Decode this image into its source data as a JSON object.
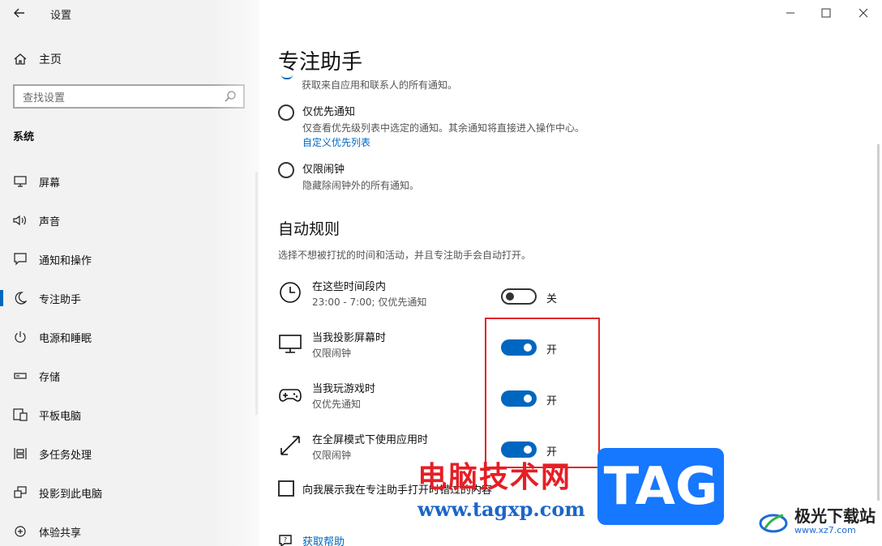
{
  "app": {
    "title": "设置",
    "back_icon": "back-arrow-icon"
  },
  "window_controls": {
    "minimize": "minimize-icon",
    "maximize": "maximize-icon",
    "close": "close-icon"
  },
  "sidebar": {
    "home_label": "主页",
    "search_placeholder": "查找设置",
    "section": "系统",
    "items": [
      {
        "label": "屏幕",
        "icon": "monitor-icon"
      },
      {
        "label": "声音",
        "icon": "speaker-icon"
      },
      {
        "label": "通知和操作",
        "icon": "message-icon"
      },
      {
        "label": "专注助手",
        "icon": "moon-icon",
        "active": true
      },
      {
        "label": "电源和睡眠",
        "icon": "power-icon"
      },
      {
        "label": "存储",
        "icon": "storage-icon"
      },
      {
        "label": "平板电脑",
        "icon": "tablet-icon"
      },
      {
        "label": "多任务处理",
        "icon": "multitask-icon"
      },
      {
        "label": "投影到此电脑",
        "icon": "project-icon"
      },
      {
        "label": "体验共享",
        "icon": "share-icon"
      }
    ]
  },
  "main": {
    "title": "专注助手",
    "partial_desc": "获取来自应用和联系人的所有通知。",
    "options": [
      {
        "title": "仅优先通知",
        "desc": "仅查看优先级列表中选定的通知。其余通知将直接进入操作中心。",
        "link": "自定义优先列表"
      },
      {
        "title": "仅限闹钟",
        "desc": "隐藏除闹钟外的所有通知。"
      }
    ],
    "auto_rules": {
      "heading": "自动规则",
      "desc": "选择不想被打扰的时间和活动，并且专注助手会自动打开。",
      "rules": [
        {
          "title": "在这些时间段内",
          "desc": "23:00 - 7:00; 仅优先通知",
          "state": "关",
          "on": false,
          "icon": "clock-icon"
        },
        {
          "title": "当我投影屏幕时",
          "desc": "仅限闹钟",
          "state": "开",
          "on": true,
          "icon": "monitor-icon"
        },
        {
          "title": "当我玩游戏时",
          "desc": "仅优先通知",
          "state": "开",
          "on": true,
          "icon": "gamepad-icon"
        },
        {
          "title": "在全屏模式下使用应用时",
          "desc": "仅限闹钟",
          "state": "开",
          "on": true,
          "icon": "resize-diagonal-icon"
        }
      ]
    },
    "checkbox_label": "向我展示我在专注助手打开时错过的内容",
    "help_link": "获取帮助"
  },
  "watermark": {
    "cn_text": "电脑技术网",
    "url": "www.tagxp.com",
    "tag": "TAG",
    "site_name": "极光下载站",
    "site_url": "www.xz7.com"
  }
}
